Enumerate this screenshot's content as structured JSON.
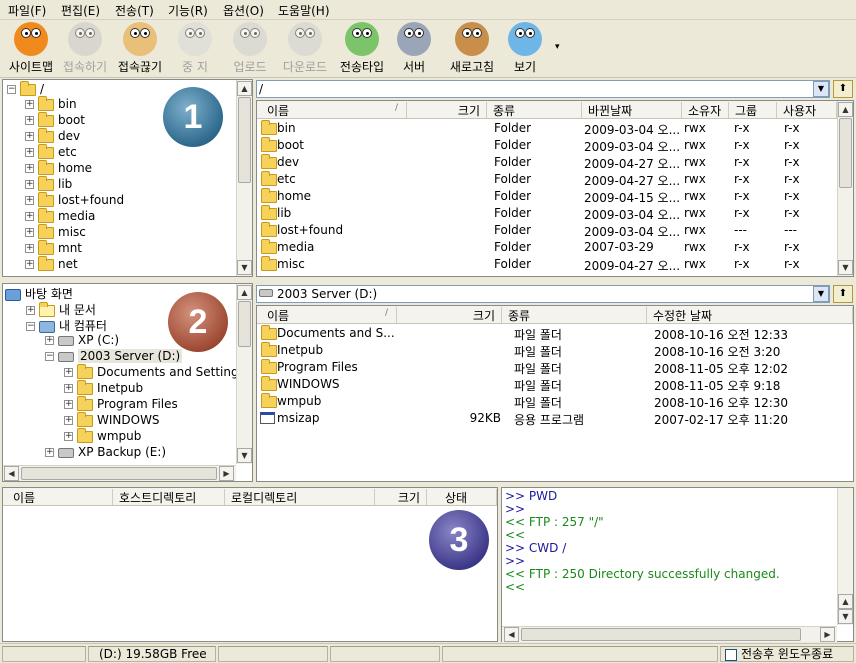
{
  "menu": [
    "파일(F)",
    "편집(E)",
    "전송(T)",
    "기능(R)",
    "옵션(O)",
    "도움말(H)"
  ],
  "toolbar": [
    {
      "label": "사이트맵",
      "enabled": true,
      "color": "#f08a1c"
    },
    {
      "label": "접속하기",
      "enabled": false,
      "color": "#c8c8c8"
    },
    {
      "label": "접속끊기",
      "enabled": true,
      "color": "#e8c07a"
    },
    {
      "label": "중 지",
      "enabled": false,
      "color": "#d8d8d8"
    },
    {
      "label": "업로드",
      "enabled": false,
      "color": "#d0d0d0"
    },
    {
      "label": "다운로드",
      "enabled": false,
      "color": "#d0d0d0"
    },
    {
      "label": "전송타입",
      "enabled": true,
      "color": "#7cc46a"
    },
    {
      "label": "서버",
      "enabled": true,
      "color": "#9aa6b8"
    },
    {
      "label": "새로고침",
      "enabled": true,
      "color": "#c88e4a"
    },
    {
      "label": "보기",
      "enabled": true,
      "color": "#6fb6e8"
    }
  ],
  "remote": {
    "tree_root": "/",
    "tree": [
      "bin",
      "boot",
      "dev",
      "etc",
      "home",
      "lib",
      "lost+found",
      "media",
      "misc",
      "mnt",
      "net"
    ],
    "path": "/",
    "columns": [
      "이름",
      "크기",
      "종류",
      "바뀐날짜",
      "소유자",
      "그룹",
      "사용자"
    ],
    "rows": [
      [
        "bin",
        "",
        "Folder",
        "2009-03-04 오...",
        "rwx",
        "r-x",
        "r-x"
      ],
      [
        "boot",
        "",
        "Folder",
        "2009-03-04 오...",
        "rwx",
        "r-x",
        "r-x"
      ],
      [
        "dev",
        "",
        "Folder",
        "2009-04-27 오...",
        "rwx",
        "r-x",
        "r-x"
      ],
      [
        "etc",
        "",
        "Folder",
        "2009-04-27 오...",
        "rwx",
        "r-x",
        "r-x"
      ],
      [
        "home",
        "",
        "Folder",
        "2009-04-15 오...",
        "rwx",
        "r-x",
        "r-x"
      ],
      [
        "lib",
        "",
        "Folder",
        "2009-03-04 오...",
        "rwx",
        "r-x",
        "r-x"
      ],
      [
        "lost+found",
        "",
        "Folder",
        "2009-03-04 오...",
        "rwx",
        "---",
        "---"
      ],
      [
        "media",
        "",
        "Folder",
        "2007-03-29",
        "rwx",
        "r-x",
        "r-x"
      ],
      [
        "misc",
        "",
        "Folder",
        "2009-04-27 오...",
        "rwx",
        "r-x",
        "r-x"
      ]
    ]
  },
  "local": {
    "tree": [
      {
        "label": "바탕 화면",
        "level": 0,
        "pm": "",
        "icon": "desktop"
      },
      {
        "label": "내 문서",
        "level": 1,
        "pm": "+",
        "icon": "doc"
      },
      {
        "label": "내 컴퓨터",
        "level": 1,
        "pm": "-",
        "icon": "pc"
      },
      {
        "label": "XP (C:)",
        "level": 2,
        "pm": "+",
        "icon": "drive"
      },
      {
        "label": "2003 Server (D:)",
        "level": 2,
        "pm": "-",
        "icon": "drive"
      },
      {
        "label": "Documents and Settings",
        "level": 3,
        "pm": "+",
        "icon": "folder"
      },
      {
        "label": "Inetpub",
        "level": 3,
        "pm": "+",
        "icon": "folder"
      },
      {
        "label": "Program Files",
        "level": 3,
        "pm": "+",
        "icon": "folder"
      },
      {
        "label": "WINDOWS",
        "level": 3,
        "pm": "+",
        "icon": "folder"
      },
      {
        "label": "wmpub",
        "level": 3,
        "pm": "+",
        "icon": "folder"
      },
      {
        "label": "XP Backup (E:)",
        "level": 2,
        "pm": "+",
        "icon": "drive"
      }
    ],
    "path": "2003 Server (D:)",
    "columns": [
      "이름",
      "크기",
      "종류",
      "수정한 날짜"
    ],
    "rows": [
      [
        "Documents and S...",
        "",
        "파일 폴더",
        "2008-10-16 오전 12:33",
        "folder"
      ],
      [
        "Inetpub",
        "",
        "파일 폴더",
        "2008-10-16 오전 3:20",
        "folder"
      ],
      [
        "Program Files",
        "",
        "파일 폴더",
        "2008-11-05 오후 12:02",
        "folder"
      ],
      [
        "WINDOWS",
        "",
        "파일 폴더",
        "2008-11-05 오후 9:18",
        "folder"
      ],
      [
        "wmpub",
        "",
        "파일 폴더",
        "2008-10-16 오후 12:30",
        "folder"
      ],
      [
        "msizap",
        "92KB",
        "응용 프로그램",
        "2007-02-17 오후 11:20",
        "app"
      ]
    ]
  },
  "queue": {
    "columns": [
      "이름",
      "호스트디렉토리",
      "로컬디렉토리",
      "크기",
      "상태"
    ]
  },
  "log": [
    {
      "text": ">> PWD",
      "color": "#1a1a9a"
    },
    {
      "text": ">>",
      "color": "#1a1a9a"
    },
    {
      "text": "<< FTP : 257 \"/\"",
      "color": "#1a8a1a"
    },
    {
      "text": "<<",
      "color": "#1a8a1a"
    },
    {
      "text": ">> CWD /",
      "color": "#1a1a9a"
    },
    {
      "text": ">>",
      "color": "#1a1a9a"
    },
    {
      "text": "<< FTP : 250 Directory successfully changed.",
      "color": "#1a8a1a"
    },
    {
      "text": "<<",
      "color": "#1a8a1a"
    }
  ],
  "badges": [
    "1",
    "2",
    "3"
  ],
  "status": {
    "drive": "(D:)  19.58GB Free",
    "checkbox_label": "전송후 윈도우종료"
  }
}
